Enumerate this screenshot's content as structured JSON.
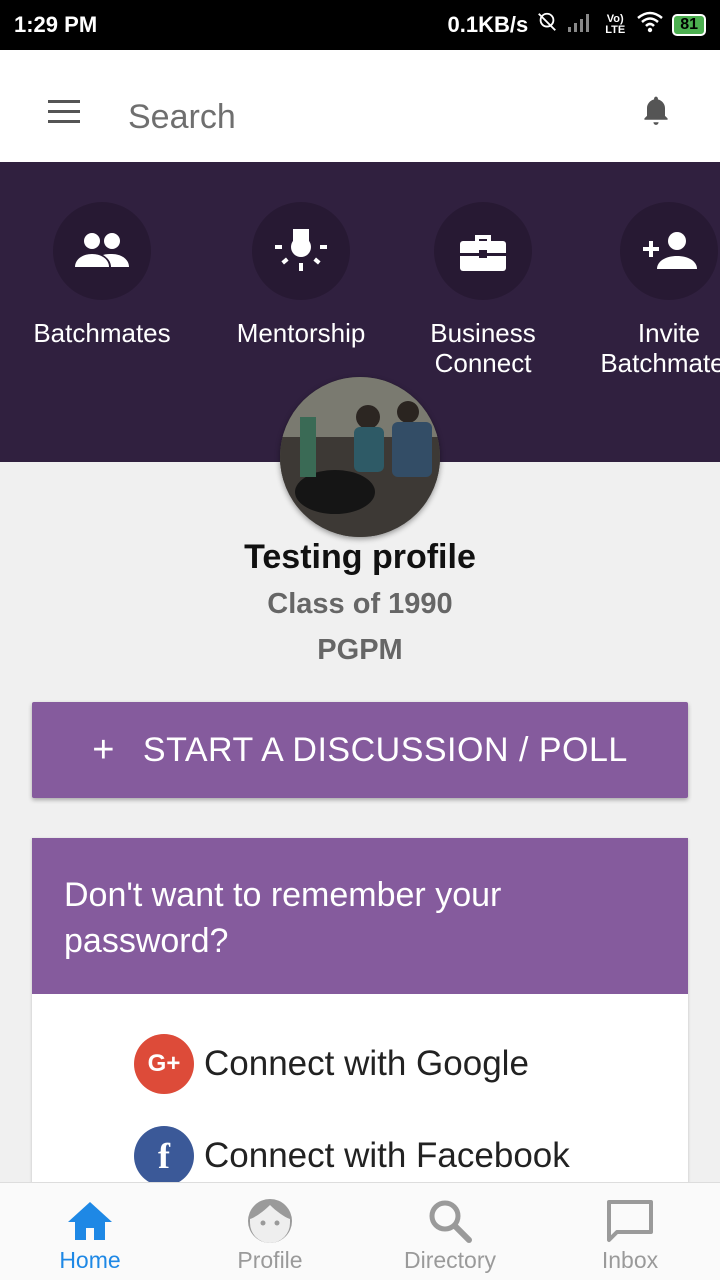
{
  "status_bar": {
    "time": "1:29 PM",
    "speed": "0.1KB/s",
    "network": "Vo) LTE",
    "battery": "81"
  },
  "appbar": {
    "search_placeholder": "Search"
  },
  "quick_actions": [
    {
      "label": "Batchmates",
      "icon": "group-icon"
    },
    {
      "label": "Mentorship",
      "icon": "lightbulb-icon"
    },
    {
      "label": "Business Connect",
      "icon": "briefcase-icon"
    },
    {
      "label": "Invite Batchmates",
      "icon": "person-add-icon"
    }
  ],
  "profile": {
    "name": "Testing profile",
    "class": "Class of 1990",
    "program": "PGPM"
  },
  "start_discussion": {
    "plus": "+",
    "label": "START A DISCUSSION / POLL"
  },
  "password_card": {
    "title": "Don't want to remember your password?",
    "google_label": "Connect with Google",
    "google_logo": "G+",
    "facebook_label": "Connect with Facebook",
    "facebook_logo": "f"
  },
  "bottom_nav": [
    {
      "label": "Home",
      "icon": "home-icon",
      "active": true
    },
    {
      "label": "Profile",
      "icon": "face-icon",
      "active": false
    },
    {
      "label": "Directory",
      "icon": "search-icon",
      "active": false
    },
    {
      "label": "Inbox",
      "icon": "chat-icon",
      "active": false
    }
  ],
  "colors": {
    "header_bg": "#30203f",
    "accent_purple": "#855b9d",
    "active_nav": "#1e88e5",
    "google_red": "#dd4b39",
    "facebook_blue": "#3b5998"
  }
}
